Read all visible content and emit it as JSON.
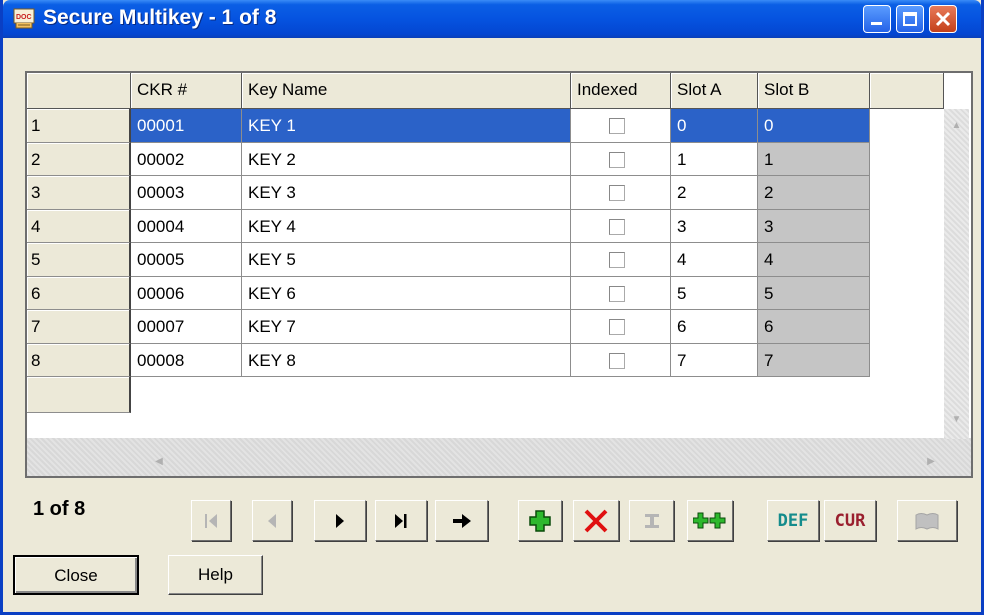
{
  "window": {
    "title": "Secure Multikey - 1 of 8",
    "app_icon": "doc-icon"
  },
  "grid": {
    "columns": [
      "",
      "CKR #",
      "Key Name",
      "Indexed",
      "Slot A",
      "Slot B"
    ],
    "rows": [
      {
        "row": "1",
        "ckr": "00001",
        "key_name": "KEY 1",
        "indexed": false,
        "slot_a": "0",
        "slot_b": "0"
      },
      {
        "row": "2",
        "ckr": "00002",
        "key_name": "KEY 2",
        "indexed": false,
        "slot_a": "1",
        "slot_b": "1"
      },
      {
        "row": "3",
        "ckr": "00003",
        "key_name": "KEY 3",
        "indexed": false,
        "slot_a": "2",
        "slot_b": "2"
      },
      {
        "row": "4",
        "ckr": "00004",
        "key_name": "KEY 4",
        "indexed": false,
        "slot_a": "3",
        "slot_b": "3"
      },
      {
        "row": "5",
        "ckr": "00005",
        "key_name": "KEY 5",
        "indexed": false,
        "slot_a": "4",
        "slot_b": "4"
      },
      {
        "row": "6",
        "ckr": "00006",
        "key_name": "KEY 6",
        "indexed": false,
        "slot_a": "5",
        "slot_b": "5"
      },
      {
        "row": "7",
        "ckr": "00007",
        "key_name": "KEY 7",
        "indexed": false,
        "slot_a": "6",
        "slot_b": "6"
      },
      {
        "row": "8",
        "ckr": "00008",
        "key_name": "KEY 8",
        "indexed": false,
        "slot_a": "7",
        "slot_b": "7"
      }
    ],
    "selected_row": 0
  },
  "navigator": {
    "record_count": "1 of 8",
    "def_label": "DEF",
    "cur_label": "CUR",
    "icons": [
      "first-record-icon",
      "prior-record-icon",
      "next-record-icon",
      "last-record-icon",
      "goto-arrow-icon",
      "insert-plus-icon",
      "delete-x-icon",
      "edit-icon",
      "refresh-icon",
      "default-icon",
      "current-icon",
      "book-icon"
    ]
  },
  "buttons": {
    "close": "Close",
    "help": "Help"
  },
  "colors": {
    "title_bar": "#0553e0",
    "selection": "#2b62c8",
    "slot_b_bg": "#c5c5c5",
    "face": "#ece9d8",
    "plus_green": "#2db82d",
    "delete_red": "#e01010",
    "def_text": "#148c8c",
    "cur_text": "#9a1f2e"
  }
}
